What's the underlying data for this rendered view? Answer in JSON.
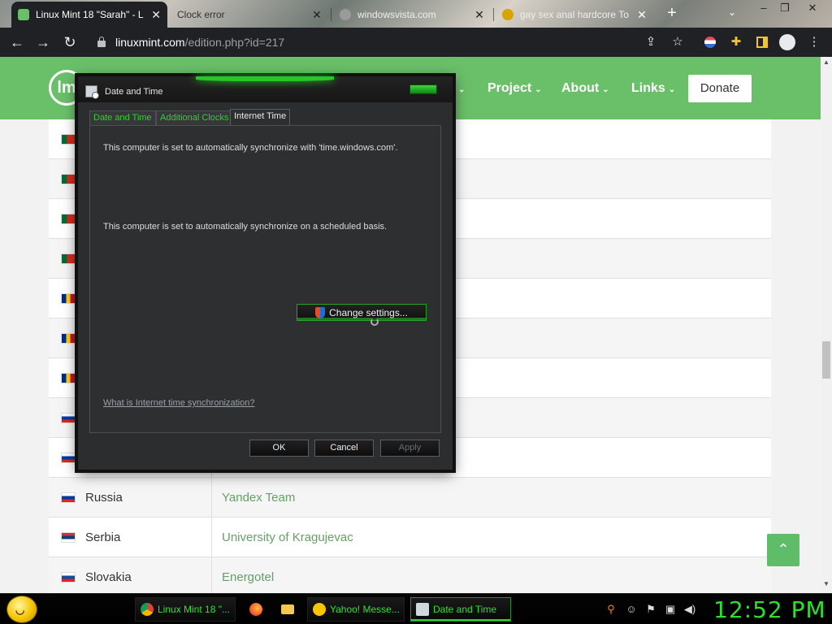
{
  "browser": {
    "tabs": [
      {
        "title": "Linux Mint 18 \"Sarah\" - L",
        "active": true
      },
      {
        "title": "Clock error",
        "active": false
      },
      {
        "title": "windowsvista.com",
        "active": false
      },
      {
        "title": "gay sex anal hardcore  To",
        "active": false
      }
    ],
    "new_tab_symbol": "+",
    "url_host": "linuxmint.com",
    "url_path": "/edition.php?id=217",
    "window_controls": [
      "–",
      "❐",
      "✕"
    ]
  },
  "site": {
    "logo_text": "lm",
    "nav": [
      {
        "label": "Project"
      },
      {
        "label": "About"
      },
      {
        "label": "Links"
      }
    ],
    "donate_label": "Donate",
    "mirrors": [
      {
        "country": "",
        "mirror": "",
        "flag": "portugal"
      },
      {
        "country": "",
        "mirror": "",
        "flag": "portugal"
      },
      {
        "country": "",
        "mirror": "",
        "flag": "portugal"
      },
      {
        "country": "",
        "mirror": "",
        "flag": "portugal"
      },
      {
        "country": "",
        "mirror": "",
        "flag": "romania"
      },
      {
        "country": "",
        "mirror": "",
        "flag": "romania"
      },
      {
        "country": "",
        "mirror": "",
        "flag": "romania"
      },
      {
        "country": "",
        "mirror": "",
        "flag": "russia"
      },
      {
        "country": "",
        "mirror": "",
        "flag": "russia"
      },
      {
        "country": "Russia",
        "mirror": "Yandex Team",
        "flag": "russia"
      },
      {
        "country": "Serbia",
        "mirror": "University of Kragujevac",
        "flag": "serbia"
      },
      {
        "country": "Slovakia",
        "mirror": "Energotel",
        "flag": "slovakia"
      }
    ],
    "scroll_top_symbol": "⌃"
  },
  "dialog": {
    "title": "Date and Time",
    "tabs": [
      "Date and Time",
      "Additional Clocks",
      "Internet Time"
    ],
    "active_tab": "Internet Time",
    "sync_message": "This computer is set to automatically synchronize with 'time.windows.com'.",
    "schedule_message": "This computer is set to automatically synchronize on a scheduled basis.",
    "change_settings_label": "Change settings...",
    "help_link": "What is Internet time synchronization?",
    "ok_label": "OK",
    "cancel_label": "Cancel",
    "apply_label": "Apply"
  },
  "taskbar": {
    "items": [
      {
        "label": "Linux Mint 18 \"...",
        "icon": "chrome-icon"
      },
      {
        "label": "Yahoo! Messe...",
        "icon": "yahoo-messenger-icon"
      },
      {
        "label": "Date and Time",
        "icon": "date-time-icon"
      }
    ],
    "clock": "12:52 PM"
  },
  "colors": {
    "mint_green": "#6abf69",
    "mint_link": "#62a262",
    "dialog_accent": "#28c728",
    "taskbar_text": "#2ee02e"
  }
}
